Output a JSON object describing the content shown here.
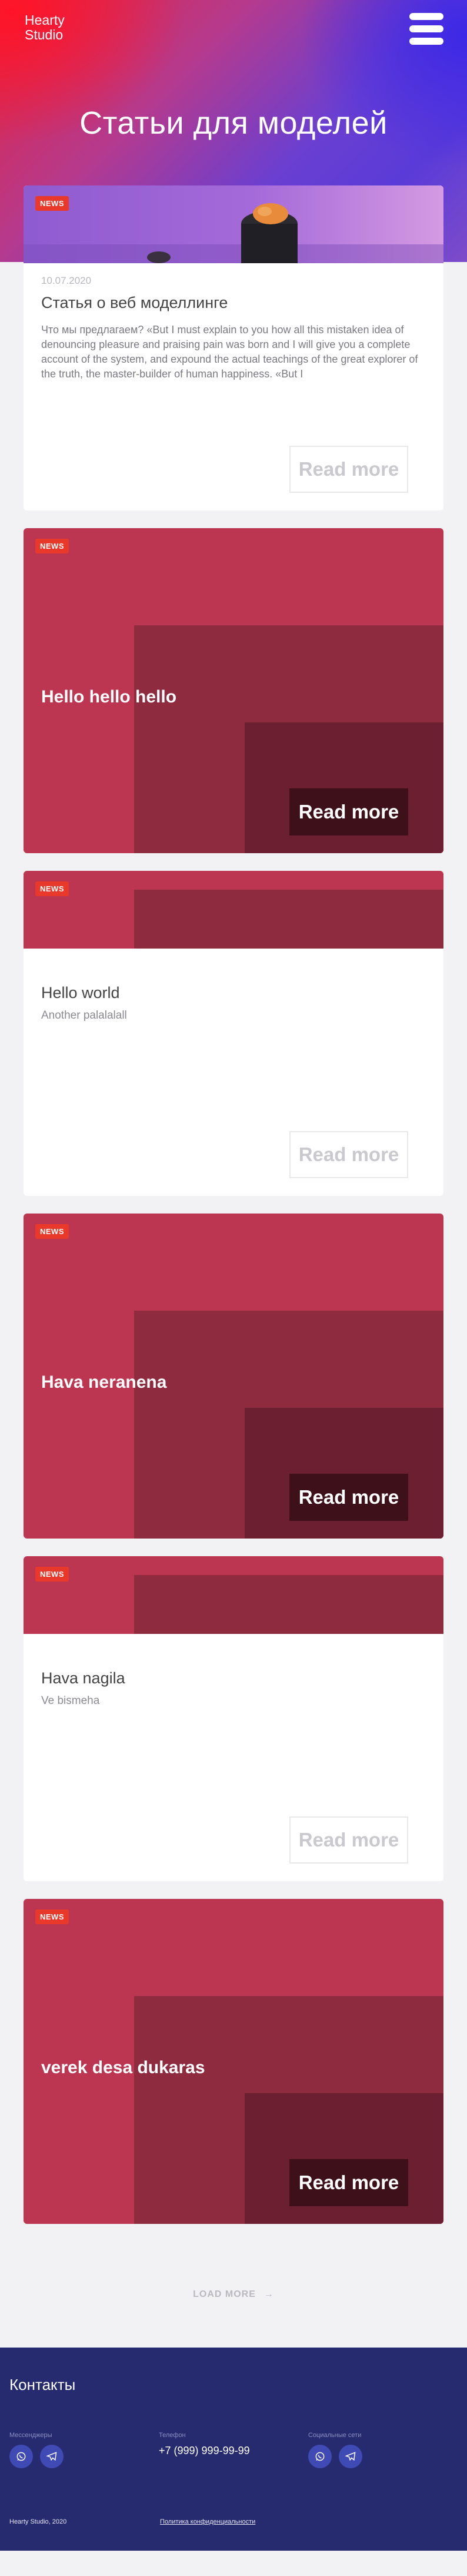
{
  "header": {
    "logo_line1": "Hearty",
    "logo_line2": "Studio",
    "page_title": "Статьи для моделей"
  },
  "articles": [
    {
      "badge": "NEWS",
      "date": "10.07.2020",
      "title": "Статья о веб моделлинге",
      "text": "Что мы предлагаем? «But I must explain to you how all this mistaken idea of denouncing pleasure and praising pain was born and I will give you a complete account of the system, and expound the actual teachings of the great explorer of the truth, the master-builder of human happiness. «But I",
      "read_more": "Read more"
    },
    {
      "badge": "NEWS",
      "title": "Hello hello hello",
      "read_more": "Read more"
    },
    {
      "badge": "NEWS",
      "title": "Hello world",
      "subtitle": "Another palalalall",
      "read_more": "Read more"
    },
    {
      "badge": "NEWS",
      "title": "Hava neranena",
      "read_more": "Read more"
    },
    {
      "badge": "NEWS",
      "title": "Hava nagila",
      "subtitle": "Ve bismeha",
      "read_more": "Read more"
    },
    {
      "badge": "NEWS",
      "title": "verek desa dukaras",
      "read_more": "Read more"
    }
  ],
  "load_more": "LOAD MORE",
  "footer": {
    "title": "Контакты",
    "messengers_label": "Мессенджеры",
    "phone_label": "Телефон",
    "phone": "+7 (999) 999-99-99",
    "social_label": "Социальные сети",
    "copyright": "Hearty Studio, 2020",
    "privacy": "Политика конфиденциальности"
  },
  "colors": {
    "accent_red": "#bd3651",
    "badge_red": "#e8392a",
    "footer_blue": "#262a6f"
  }
}
